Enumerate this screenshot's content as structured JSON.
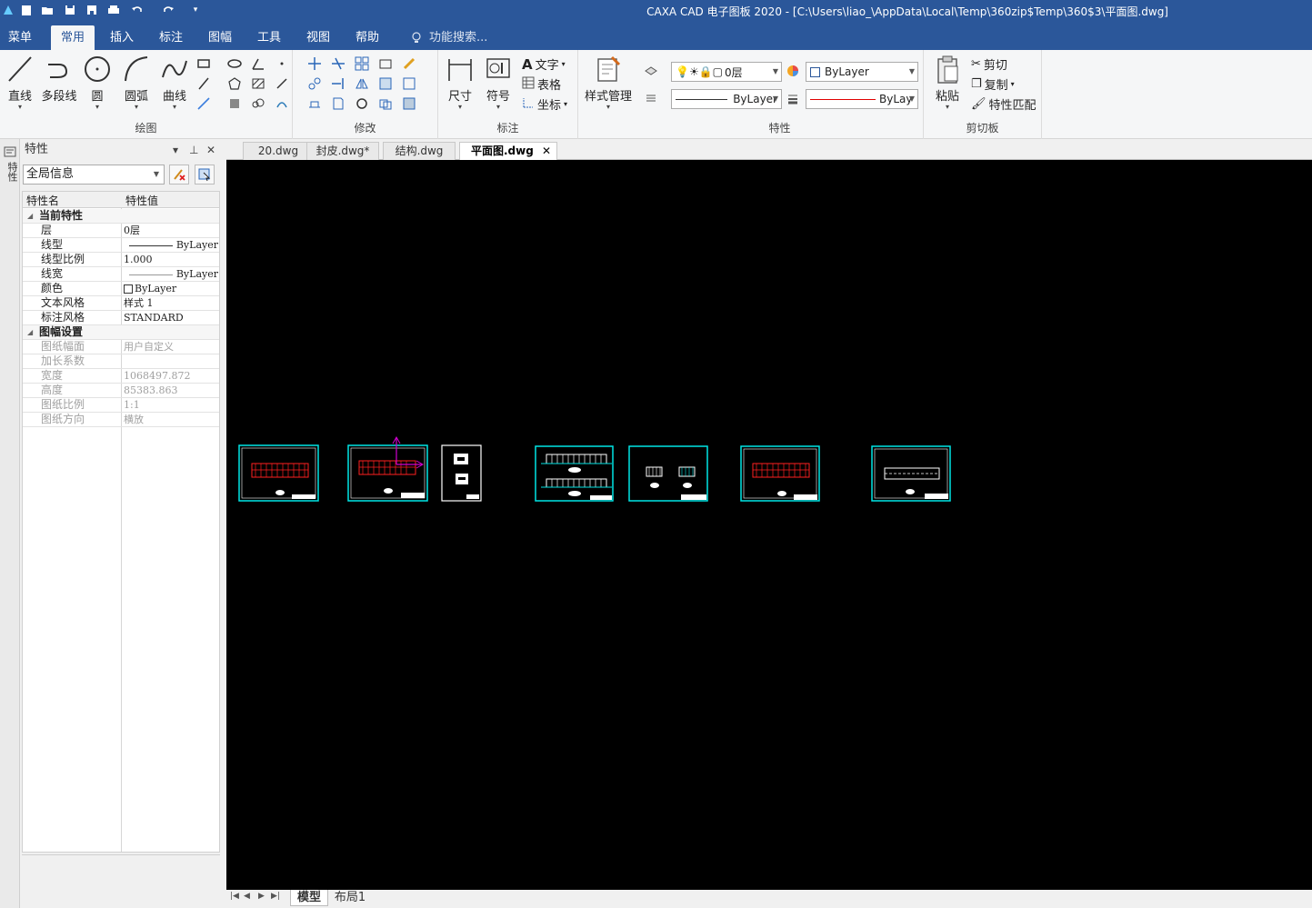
{
  "window": {
    "title": "CAXA CAD 电子图板 2020 - [C:\\Users\\liao_\\AppData\\Local\\Temp\\360zip$Temp\\360$3\\平面图.dwg]"
  },
  "menubar": {
    "tabs": [
      "菜单",
      "常用",
      "插入",
      "标注",
      "图幅",
      "工具",
      "视图",
      "帮助"
    ],
    "active": "常用",
    "search_placeholder": "功能搜索..."
  },
  "ribbon": {
    "draw": {
      "label": "绘图",
      "line": "直线",
      "polyline": "多段线",
      "circle": "圆",
      "arc": "圆弧",
      "curve": "曲线"
    },
    "modify": {
      "label": "修改"
    },
    "annotate": {
      "label": "标注",
      "dimension": "尺寸",
      "symbol": "符号",
      "text": "文字",
      "table": "表格",
      "coordinate": "坐标"
    },
    "style": {
      "label": "样式管理"
    },
    "properties": {
      "label": "特性",
      "layer": "0层",
      "color": "ByLayer",
      "linetype": "ByLayer",
      "linewidth": "ByLay"
    },
    "clipboard": {
      "label": "剪切板",
      "paste": "粘贴",
      "cut": "剪切",
      "copy": "复制",
      "match": "特性匹配"
    }
  },
  "panel": {
    "title": "特性",
    "side_caption": "特性",
    "scope": "全局信息",
    "col_name": "特性名",
    "col_value": "特性值",
    "cat_current": "当前特性",
    "cat_sheet": "图幅设置",
    "current": [
      {
        "k": "层",
        "v": "0层"
      },
      {
        "k": "线型",
        "v": "ByLayer"
      },
      {
        "k": "线型比例",
        "v": "1.000"
      },
      {
        "k": "线宽",
        "v": "ByLayer"
      },
      {
        "k": "颜色",
        "v": "ByLayer"
      },
      {
        "k": "文本风格",
        "v": "样式 1"
      },
      {
        "k": "标注风格",
        "v": "STANDARD"
      }
    ],
    "sheet": [
      {
        "k": "图纸幅面",
        "v": "用户自定义"
      },
      {
        "k": "加长系数",
        "v": ""
      },
      {
        "k": "宽度",
        "v": "1068497.872"
      },
      {
        "k": "高度",
        "v": "85383.863"
      },
      {
        "k": "图纸比例",
        "v": "1:1"
      },
      {
        "k": "图纸方向",
        "v": "横放"
      }
    ]
  },
  "doc_tabs": [
    "20.dwg",
    "封皮.dwg*",
    "结构.dwg",
    "平面图.dwg"
  ],
  "active_doc": "平面图.dwg",
  "layout_tabs": [
    "模型",
    "布局1"
  ],
  "colors": {
    "titlebar": "#2b579a",
    "canvas": "#000000",
    "frame": "#00e5e5",
    "plan": "#ff2020",
    "ucs": "#d000d0"
  }
}
